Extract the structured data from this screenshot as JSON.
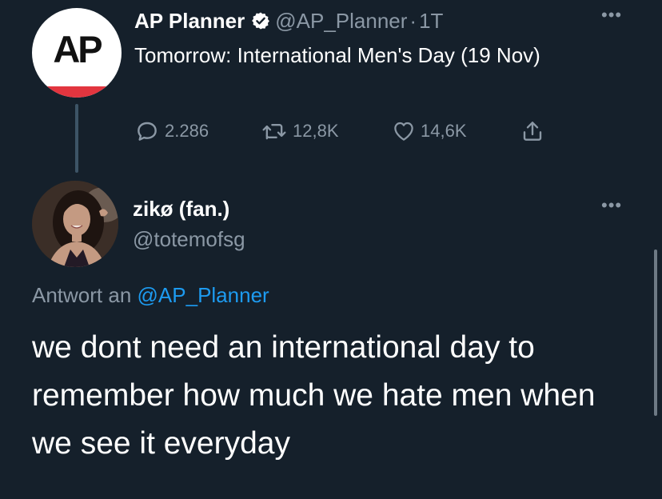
{
  "parent_tweet": {
    "avatar_text": "AP",
    "display_name": "AP Planner",
    "handle": "@AP_Planner",
    "separator": "·",
    "time": "1T",
    "text": "Tomorrow: International Men's Day (19 Nov)",
    "replies": "2.286",
    "retweets": "12,8K",
    "likes": "14,6K"
  },
  "reply_tweet": {
    "display_name": "zikø (fan.)",
    "handle": "@totemofsg",
    "reply_prefix": "Antwort an",
    "reply_mention": "@AP_Planner",
    "text": "we dont need an international day to remember how much we hate men when we see it everyday"
  },
  "icons": {
    "more": "more-horizontal-icon",
    "verified": "verified-badge-icon",
    "reply": "comment-icon",
    "retweet": "retweet-icon",
    "like": "heart-icon",
    "share": "share-icon"
  },
  "colors": {
    "background": "#15202b",
    "text_primary": "#ffffff",
    "text_secondary": "#8b98a5",
    "accent": "#1d9bf0",
    "ap_red": "#e2353f"
  }
}
